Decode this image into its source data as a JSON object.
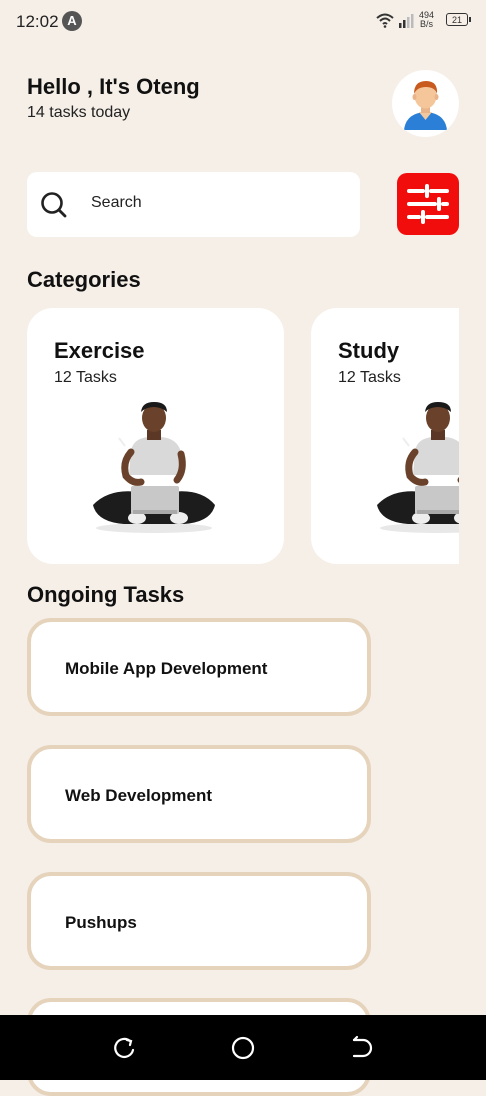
{
  "status_bar": {
    "time": "12:02",
    "app_badge": "A",
    "net_speed_value": "494",
    "net_speed_unit": "B/s",
    "battery": "21"
  },
  "header": {
    "greeting": "Hello , It's Oteng",
    "subtitle": "14 tasks today",
    "avatar_icon": "user-avatar-icon"
  },
  "search": {
    "placeholder": "Search",
    "icon": "search-icon"
  },
  "filter": {
    "icon": "sliders-icon",
    "color": "#f20d0d"
  },
  "categories": {
    "title": "Categories",
    "items": [
      {
        "name": "Exercise",
        "count": "12 Tasks"
      },
      {
        "name": "Study",
        "count": "12 Tasks"
      }
    ]
  },
  "ongoing": {
    "title": "Ongoing Tasks",
    "tasks": [
      {
        "label": "Mobile App Development"
      },
      {
        "label": "Web Development"
      },
      {
        "label": "Pushups"
      },
      {
        "label": ""
      }
    ]
  },
  "colors": {
    "background": "#f6efe8",
    "task_border": "#e6d3bb",
    "accent": "#f20d0d"
  }
}
